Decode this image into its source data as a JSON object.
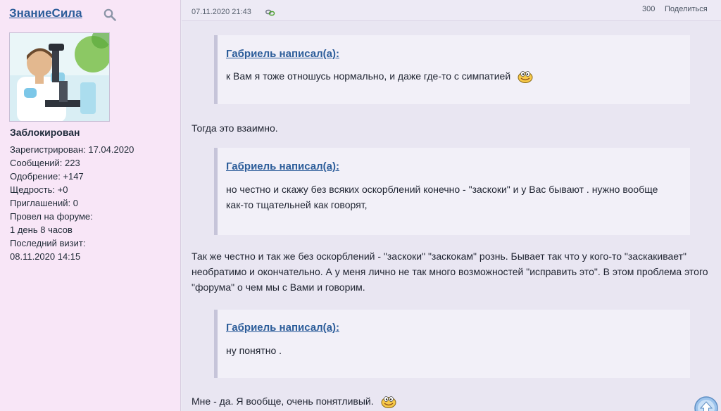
{
  "user": {
    "name": "ЗнаниеСила",
    "status": "Заблокирован",
    "stats": [
      "Зарегистрирован: 17.04.2020",
      "Сообщений: 223",
      "Одобрение: +147",
      "Щедрость: +0",
      "Приглашений: 0",
      "Провел на форуме:",
      "1 день 8 часов",
      "Последний визит:",
      "08.11.2020 14:15"
    ]
  },
  "post": {
    "date": "07.11.2020 21:43",
    "number": "300",
    "share_label": "Поделиться",
    "quotes": [
      {
        "author": "Габриель написал(а):",
        "text": "к Вам я тоже отношусь нормально, и даже где-то с симпатией"
      },
      {
        "author": "Габриель написал(а):",
        "text": "но честно и скажу без всяких оскорблений конечно - \"заскоки\" и у Вас бывают . нужно вообще как-то тщательней как говорят,"
      },
      {
        "author": "Габриель написал(а):",
        "text": "ну понятно ."
      }
    ],
    "replies": [
      "Тогда это взаимно.",
      "Так же честно и так же без оскорблений - \"заскоки\" \"заскокам\" рознь. Бывает так что у кого-то \"заскакивает\" необратимо и окончательно. А у меня лично не так много возможностей \"исправить это\". В этом проблема этого \"форума\" о чем мы с Вами и говорим.",
      "Мне - да. Я вообще, очень понятливый."
    ]
  },
  "icons": {
    "search": "search-icon",
    "link": "link-icon",
    "smiley": "smiley-icon",
    "scroll_top": "arrow-up-icon"
  },
  "colors": {
    "sidebar_bg": "#f8e6f7",
    "post_bg": "#e9e6f2",
    "link": "#2c5d9a"
  }
}
